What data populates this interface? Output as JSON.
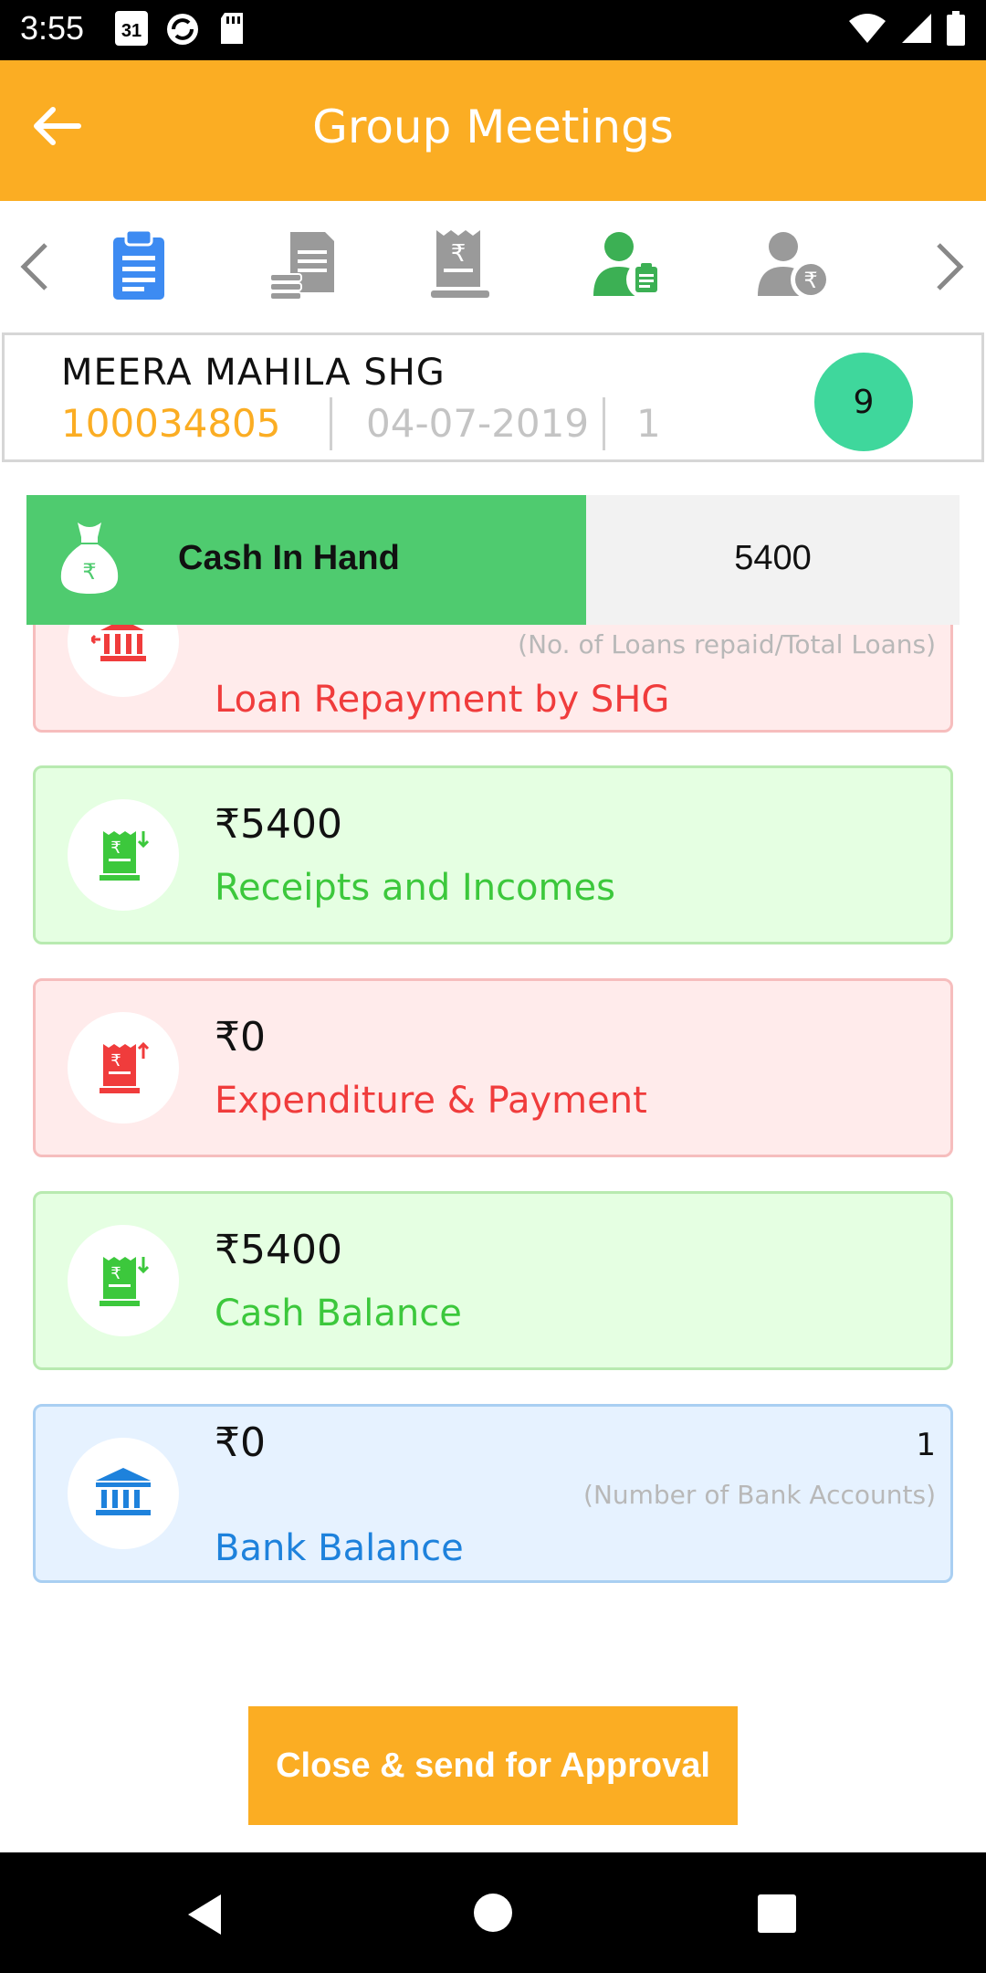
{
  "status_bar": {
    "time": "3:55",
    "calendar_day": "31"
  },
  "app_bar": {
    "title": "Group Meetings"
  },
  "tabs": [
    "meeting-clipboard-icon",
    "ledger-stack-icon",
    "receipt-rupee-icon",
    "member-clipboard-icon",
    "member-rupee-icon"
  ],
  "shg": {
    "name": "MEERA MAHILA SHG",
    "code": "100034805",
    "date": "04-07-2019",
    "number": "1",
    "badge": "9"
  },
  "cash_in_hand": {
    "label": "Cash In Hand",
    "value": "5400"
  },
  "cards": {
    "loan": {
      "note": "(No. of Loans repaid/Total Loans)",
      "label": "Loan Repayment by SHG"
    },
    "receipts": {
      "amount": "₹5400",
      "label": "Receipts and Incomes"
    },
    "expenditure": {
      "amount": "₹0",
      "label": "Expenditure & Payment"
    },
    "cash_balance": {
      "amount": "₹5400",
      "label": "Cash Balance"
    },
    "bank_balance": {
      "amount": "₹0",
      "count": "1",
      "note": "(Number of Bank Accounts)",
      "label": "Bank Balance"
    }
  },
  "approve_button": {
    "label": "Close & send for Approval"
  },
  "colors": {
    "primary": "#FBAD23",
    "cash_green": "#4FCB6F",
    "badge": "#3FD79C",
    "red": "#F03C3C",
    "green": "#3CC83C",
    "blue": "#1E82DC"
  }
}
